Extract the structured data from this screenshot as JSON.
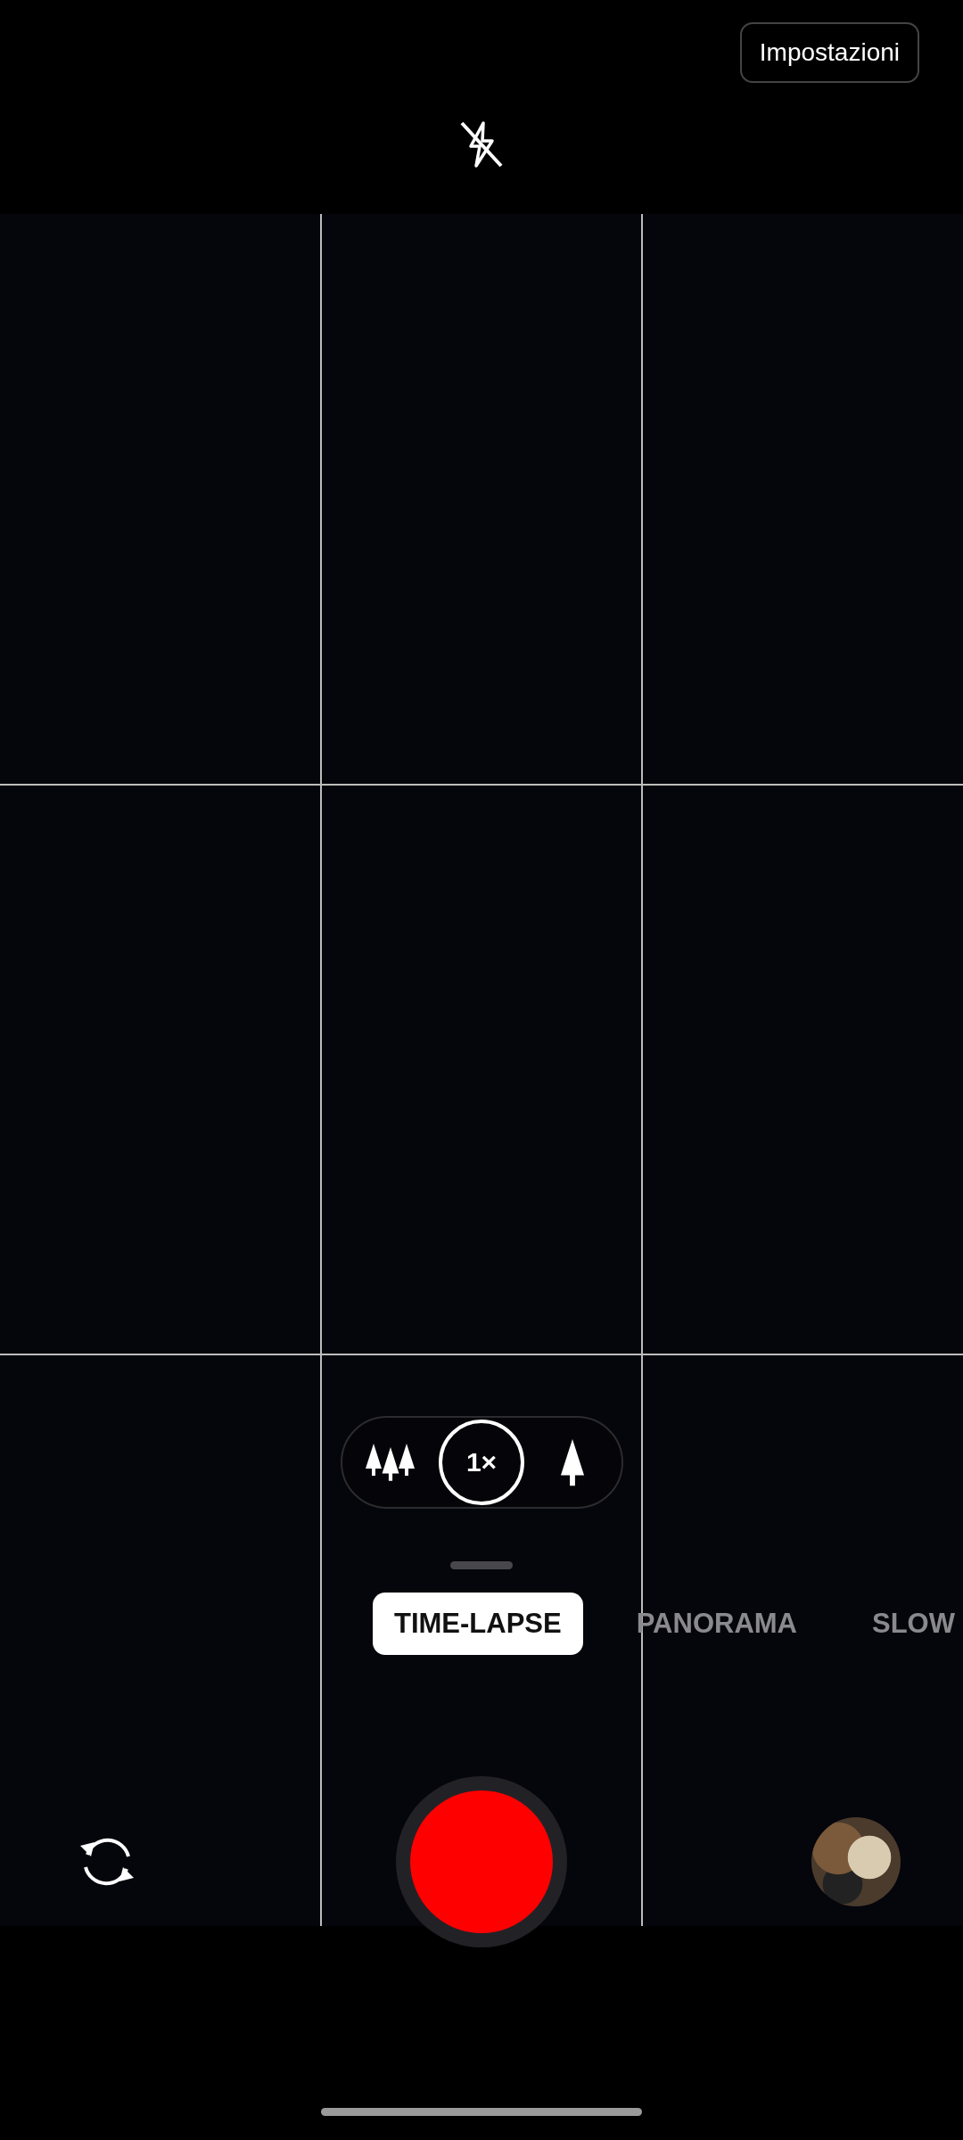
{
  "top_bar": {
    "settings_button": "Impostazioni",
    "flash": {
      "on": false
    }
  },
  "viewfinder": {
    "grid": true
  },
  "zoom_options": [
    {
      "kind": "wide",
      "selected": false
    },
    {
      "kind": "label",
      "label": "1×",
      "selected": true
    },
    {
      "kind": "tele",
      "selected": false
    }
  ],
  "modes": [
    {
      "label": "TIME-LAPSE",
      "selected": true
    },
    {
      "label": "PANORAMA",
      "selected": false
    },
    {
      "label": "SLOW",
      "selected": false
    }
  ]
}
